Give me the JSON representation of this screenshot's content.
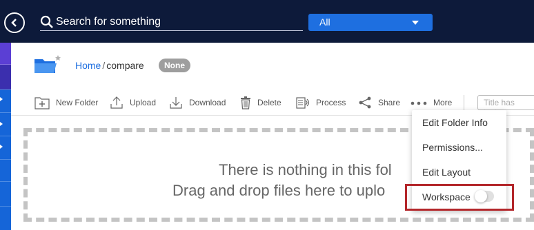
{
  "header": {
    "search_text": "Search for something",
    "scope_value": "All"
  },
  "breadcrumb": {
    "home": "Home",
    "separator": "/",
    "current": "compare"
  },
  "badge": "None",
  "toolbar": {
    "new_folder": "New Folder",
    "upload": "Upload",
    "download": "Download",
    "delete": "Delete",
    "process": "Process",
    "share": "Share",
    "more": "More",
    "title_filter_placeholder": "Title has text..."
  },
  "dropzone": {
    "line1": "There is nothing in this fol",
    "line2": "Drag and drop files here to uplo"
  },
  "more_menu": {
    "items": [
      "Edit Folder Info",
      "Permissions...",
      "Edit Layout",
      "Workspace"
    ],
    "workspace_toggle_on": false
  },
  "colors": {
    "topbar": "#0d1a3a",
    "accent": "#1e6fe0",
    "highlight": "#b3262a"
  }
}
